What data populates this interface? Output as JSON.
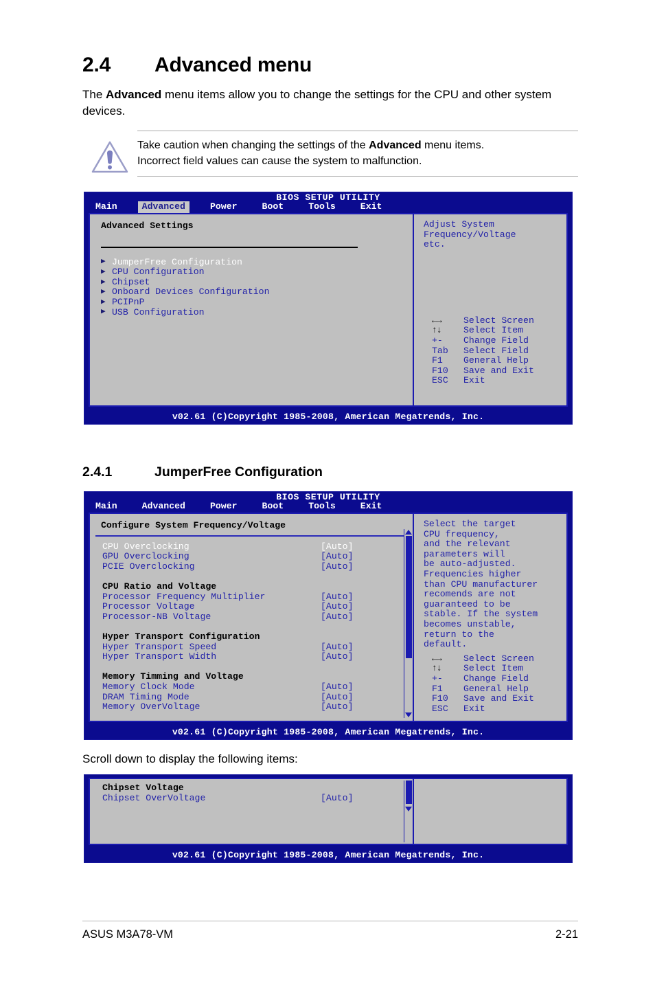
{
  "section": {
    "number": "2.4",
    "title": "Advanced menu",
    "intro_part1": "The ",
    "intro_bold": "Advanced",
    "intro_part2": " menu items allow you to change the settings for the CPU and other system devices."
  },
  "caution": {
    "icon": "warning-triangle-icon",
    "line1_part1": "Take caution when changing the settings of the ",
    "line1_bold": "Advanced",
    "line1_part2": " menu items.",
    "line2": "Incorrect field values can cause the system to malfunction."
  },
  "bios_common": {
    "title": "BIOS SETUP UTILITY",
    "footer": "v02.61 (C)Copyright 1985-2008, American Megatrends, Inc.",
    "tabs": [
      "Main",
      "Advanced",
      "Power",
      "Boot",
      "Tools",
      "Exit"
    ]
  },
  "screen1": {
    "active_tab": "Advanced",
    "pane_title": "Advanced Settings",
    "menu_items": [
      {
        "label": "JumperFree Configuration",
        "selected": true
      },
      {
        "label": "CPU Configuration",
        "selected": false
      },
      {
        "label": "Chipset",
        "selected": false
      },
      {
        "label": "Onboard Devices Configuration",
        "selected": false
      },
      {
        "label": "PCIPnP",
        "selected": false
      },
      {
        "label": "USB Configuration",
        "selected": false
      }
    ],
    "help_lines": [
      "Adjust System",
      "Frequency/Voltage",
      "etc."
    ],
    "nav_keys": [
      {
        "key": "←→",
        "glyph": true,
        "desc": "Select Screen"
      },
      {
        "key": "↑↓",
        "glyph": true,
        "desc": "Select Item"
      },
      {
        "key": "+-",
        "glyph": false,
        "desc": "Change Field"
      },
      {
        "key": "Tab",
        "glyph": false,
        "desc": "Select Field"
      },
      {
        "key": "F1",
        "glyph": false,
        "desc": "General Help"
      },
      {
        "key": "F10",
        "glyph": false,
        "desc": "Save and Exit"
      },
      {
        "key": "ESC",
        "glyph": false,
        "desc": "Exit"
      }
    ]
  },
  "subsection": {
    "number": "2.4.1",
    "title": "JumperFree Configuration"
  },
  "screen2": {
    "active_tab": "",
    "pane_title": "Configure System Frequency/Voltage",
    "rows": [
      {
        "type": "item",
        "label": "CPU Overclocking",
        "value": "[Auto]",
        "selected": true
      },
      {
        "type": "item",
        "label": "GPU Overclocking",
        "value": "[Auto]",
        "selected": false
      },
      {
        "type": "item",
        "label": "PCIE Overclocking",
        "value": "[Auto]",
        "selected": false
      },
      {
        "type": "spacer"
      },
      {
        "type": "group",
        "label": "CPU Ratio and Voltage",
        "value": ""
      },
      {
        "type": "item",
        "label": "Processor Frequency Multiplier",
        "value": "[Auto]",
        "selected": false
      },
      {
        "type": "item",
        "label": "Processor Voltage",
        "value": "[Auto]",
        "selected": false
      },
      {
        "type": "item",
        "label": "Processor-NB Voltage",
        "value": "[Auto]",
        "selected": false
      },
      {
        "type": "spacer"
      },
      {
        "type": "group",
        "label": "Hyper Transport Configuration",
        "value": ""
      },
      {
        "type": "item",
        "label": "Hyper Transport Speed",
        "value": "[Auto]",
        "selected": false
      },
      {
        "type": "item",
        "label": "Hyper Transport Width",
        "value": "[Auto]",
        "selected": false
      },
      {
        "type": "spacer"
      },
      {
        "type": "group",
        "label": "Memory Timming and Voltage",
        "value": ""
      },
      {
        "type": "item",
        "label": "Memory Clock Mode",
        "value": "[Auto]",
        "selected": false
      },
      {
        "type": "item",
        "label": "DRAM Timing Mode",
        "value": "[Auto]",
        "selected": false
      },
      {
        "type": "item",
        "label": "Memory OverVoltage",
        "value": "[Auto]",
        "selected": false
      }
    ],
    "help_lines": [
      "Select the target",
      "CPU frequency,",
      "and the relevant",
      "parameters will",
      "be auto-adjusted.",
      "Frequencies higher",
      "than CPU manufacturer",
      "recomends are not",
      "guaranteed to be",
      "stable. If the system",
      "becomes unstable,",
      "return to the",
      "default."
    ],
    "nav_keys": [
      {
        "key": "←→",
        "glyph": true,
        "desc": "Select Screen"
      },
      {
        "key": "↑↓",
        "glyph": true,
        "desc": "Select Item"
      },
      {
        "key": "+-",
        "glyph": false,
        "desc": "Change Field"
      },
      {
        "key": "F1",
        "glyph": false,
        "desc": "General Help"
      },
      {
        "key": "F10",
        "glyph": false,
        "desc": "Save and Exit"
      },
      {
        "key": "ESC",
        "glyph": false,
        "desc": "Exit"
      }
    ]
  },
  "scroll_note": "Scroll down to display the following items:",
  "screen3": {
    "rows": [
      {
        "type": "group",
        "label": "Chipset Voltage",
        "value": ""
      },
      {
        "type": "item",
        "label": "Chipset OverVoltage",
        "value": "[Auto]",
        "selected": false
      }
    ]
  },
  "page_footer": {
    "left": "ASUS M3A78-VM",
    "right": "2-21"
  },
  "colors": {
    "bios_blue": "#0b0b8f",
    "bios_gray": "#c0c0c0",
    "bios_text_blue": "#2222a8",
    "bios_border": "#1b1bb0",
    "selected_text": "#ffffff",
    "warning_icon": "#7b7fbf"
  }
}
